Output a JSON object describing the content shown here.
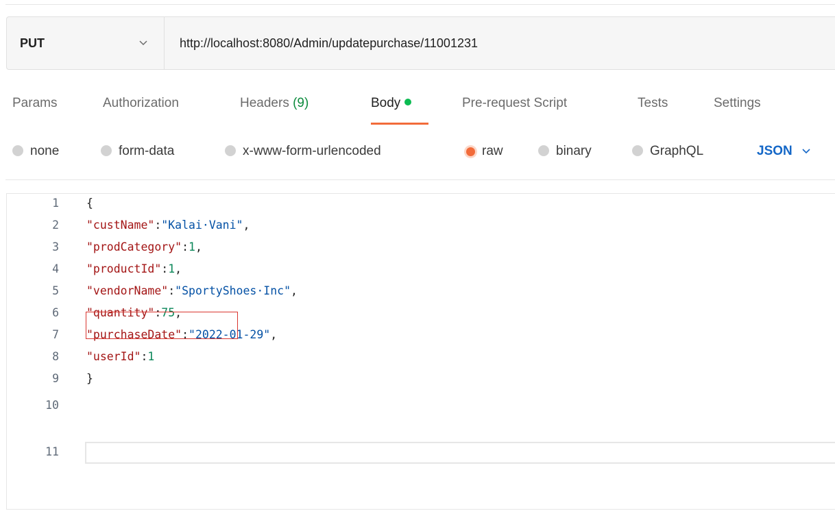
{
  "request": {
    "method": "PUT",
    "url": "http://localhost:8080/Admin/updatepurchase/11001231"
  },
  "tabs": [
    {
      "label": "Params"
    },
    {
      "label": "Authorization"
    },
    {
      "label": "Headers",
      "count": "(9)"
    },
    {
      "label": "Body",
      "active": true
    },
    {
      "label": "Pre-request Script"
    },
    {
      "label": "Tests"
    },
    {
      "label": "Settings"
    }
  ],
  "body_types": [
    {
      "label": "none"
    },
    {
      "label": "form-data"
    },
    {
      "label": "x-www-form-urlencoded"
    },
    {
      "label": "raw",
      "selected": true
    },
    {
      "label": "binary"
    },
    {
      "label": "GraphQL"
    }
  ],
  "format": "JSON",
  "editor": {
    "lines": [
      {
        "number": "1",
        "text": "{"
      },
      {
        "number": "2",
        "key": "\"custName\"",
        "sep": ":",
        "value": "\"Kalai·Vani\"",
        "end": ","
      },
      {
        "number": "3",
        "key": "\"prodCategory\"",
        "sep": ":",
        "value": "1",
        "end": ","
      },
      {
        "number": "4",
        "key": "\"productId\"",
        "sep": ":",
        "value": "1",
        "end": ","
      },
      {
        "number": "5",
        "key": "\"vendorName\"",
        "sep": ":",
        "value": "\"SportyShoes·Inc\"",
        "end": ","
      },
      {
        "number": "6",
        "key": "\"quantity\"",
        "sep": ":",
        "value": "75",
        "end": ","
      },
      {
        "number": "7",
        "key": "\"purchaseDate\"",
        "sep": ":",
        "value": "\"2022-01-29\"",
        "end": ","
      },
      {
        "number": "8",
        "key": "\"userId\"",
        "sep": ":",
        "value": "1",
        "end": ""
      },
      {
        "number": "9",
        "text": "}"
      },
      {
        "number": "10",
        "text": ""
      },
      {
        "number": "11",
        "text": ""
      }
    ]
  },
  "colors": {
    "accent": "#f26b3a",
    "active_dot": "#0cbb52",
    "json_select": "#1467c7",
    "highlight": "#d9352f"
  }
}
